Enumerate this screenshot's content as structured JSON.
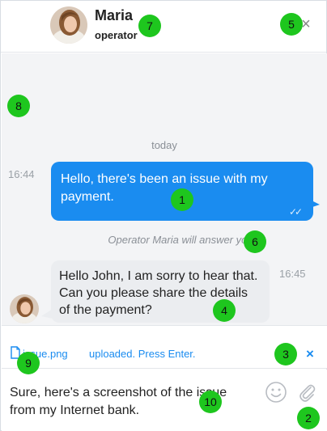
{
  "header": {
    "operator_name": "Maria",
    "operator_role": "operator",
    "close_glyph": "×"
  },
  "messages": {
    "day_separator": "today",
    "outgoing": {
      "time": "16:44",
      "text": "Hello, there's been an issue with my payment.",
      "read_glyph": "✓✓"
    },
    "system_note": "Operator Maria will answer you",
    "incoming": {
      "time": "16:45",
      "text": "Hello John, I am sorry to hear that. Can you please share the details of the payment?"
    }
  },
  "upload": {
    "file_name": "issue.png",
    "status": "uploaded. Press Enter.",
    "close_glyph": "×"
  },
  "composer": {
    "text": "Sure, here's a screenshot of the issue from my Internet bank."
  },
  "icons": {
    "close": "close-icon",
    "file": "file-icon",
    "emoji": "smiley-icon",
    "attach": "paperclip-icon",
    "avatar": "avatar"
  },
  "colors": {
    "accent": "#1a8cf0",
    "incoming_bubble": "#ebedf0",
    "message_area": "#f3f4f6",
    "marker": "#1ec61e"
  },
  "markers": [
    "1",
    "2",
    "3",
    "4",
    "5",
    "6",
    "7",
    "8",
    "9",
    "10"
  ]
}
